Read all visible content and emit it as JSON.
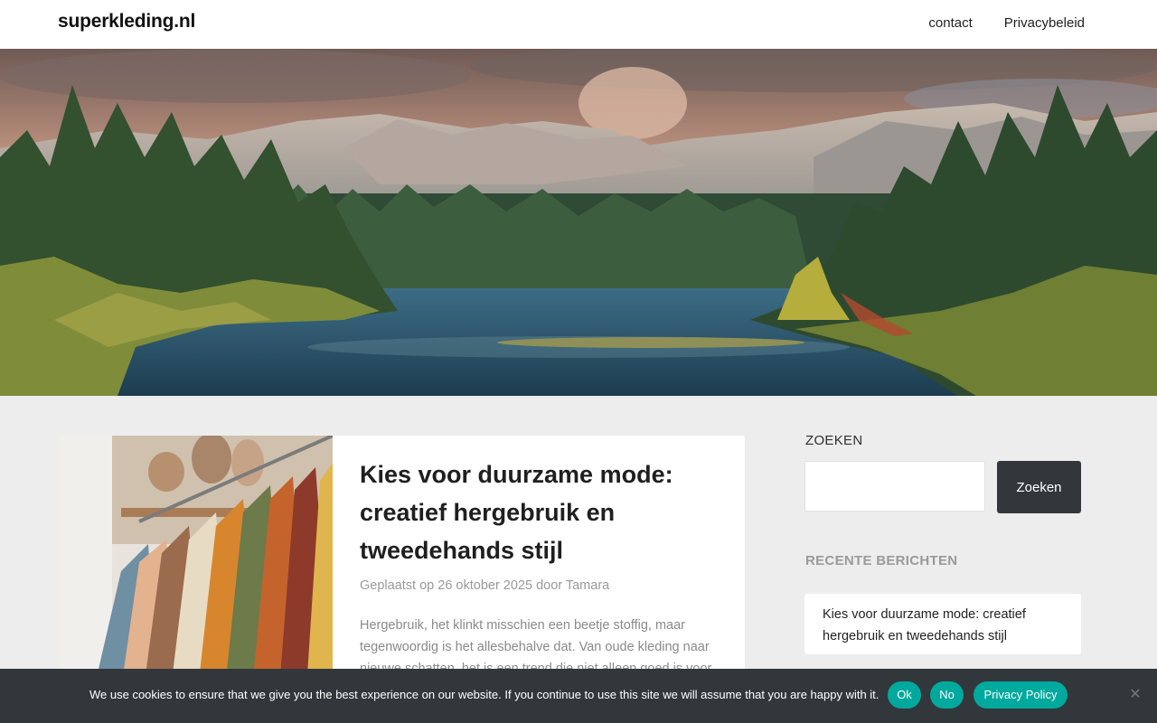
{
  "header": {
    "site_title": "superkleding.nl",
    "nav": [
      "contact",
      "Privacybeleid"
    ]
  },
  "post": {
    "title": "Kies voor duurzame mode: creatief hergebruik en tweedehands stijl",
    "meta": "Geplaatst op 26 oktober 2025 door Tamara",
    "excerpt": "Hergebruik, het klinkt misschien een beetje stoffig, maar tegenwoordig is het allesbehalve dat. Van oude kleding naar nieuwe schatten, het is een trend die niet alleen goed is voor"
  },
  "sidebar": {
    "search_title": "ZOEKEN",
    "search_button": "Zoeken",
    "search_value": "",
    "recent_title": "RECENTE BERICHTEN",
    "recent_posts": [
      "Kies voor duurzame mode: creatief hergebruik en tweedehands stijl"
    ]
  },
  "cookie": {
    "text": "We use cookies to ensure that we give you the best experience on our website. If you continue to use this site we will assume that you are happy with it.",
    "ok": "Ok",
    "no": "No",
    "policy": "Privacy Policy",
    "close_icon": "close-icon"
  },
  "colors": {
    "accent": "#00a99d",
    "cookie_bar": "#32373c",
    "button_dark": "#33373c",
    "page_bg": "#ededed"
  }
}
